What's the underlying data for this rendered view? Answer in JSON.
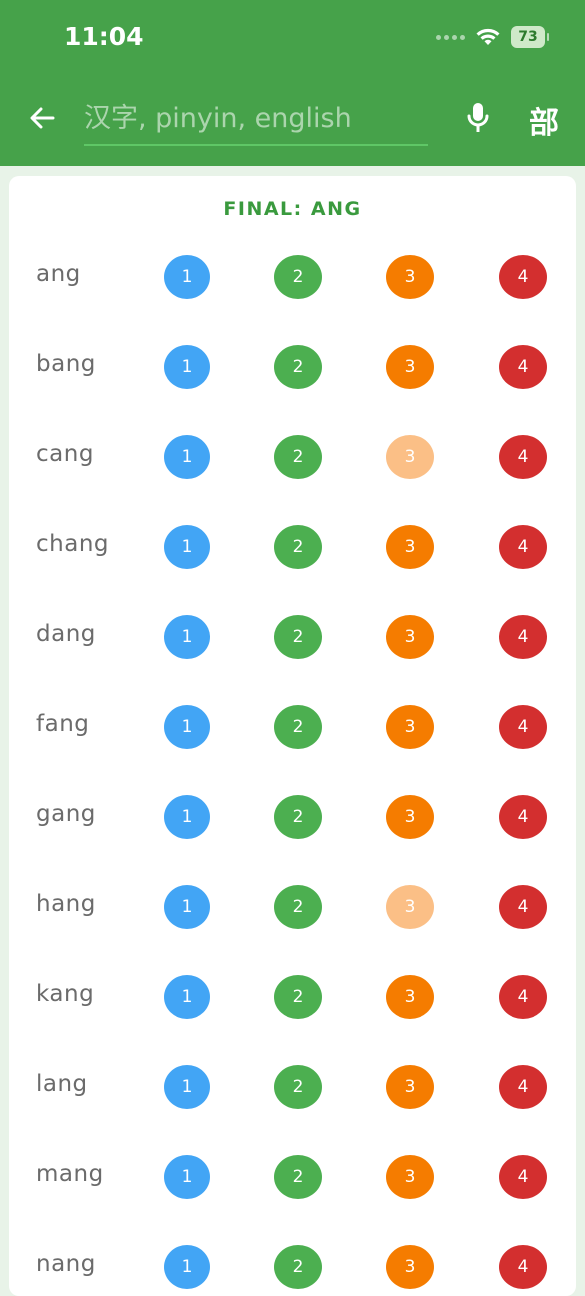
{
  "status_bar": {
    "time": "11:04",
    "battery": "73"
  },
  "header": {
    "search_placeholder": "汉字, pinyin, english",
    "search_value": "",
    "radical_label": "部"
  },
  "icons": {
    "back": "arrow-left-icon",
    "mic": "microphone-icon",
    "wifi": "wifi-icon",
    "battery": "battery-charging-icon"
  },
  "colors": {
    "appbar": "#46a24a",
    "tone1": "#42a5f5",
    "tone2": "#4caf50",
    "tone3": "#f57c00",
    "tone3_unavailable": "#fbbf86",
    "tone4": "#d32f2f",
    "title": "#3a9a3e"
  },
  "card": {
    "title": "FINAL: ANG"
  },
  "tone_labels": [
    "1",
    "2",
    "3",
    "4"
  ],
  "rows": [
    {
      "syllable": "ang",
      "tone3_available": true
    },
    {
      "syllable": "bang",
      "tone3_available": true
    },
    {
      "syllable": "cang",
      "tone3_available": false
    },
    {
      "syllable": "chang",
      "tone3_available": true
    },
    {
      "syllable": "dang",
      "tone3_available": true
    },
    {
      "syllable": "fang",
      "tone3_available": true
    },
    {
      "syllable": "gang",
      "tone3_available": true
    },
    {
      "syllable": "hang",
      "tone3_available": false
    },
    {
      "syllable": "kang",
      "tone3_available": true
    },
    {
      "syllable": "lang",
      "tone3_available": true
    },
    {
      "syllable": "mang",
      "tone3_available": true
    },
    {
      "syllable": "nang",
      "tone3_available": true
    }
  ]
}
